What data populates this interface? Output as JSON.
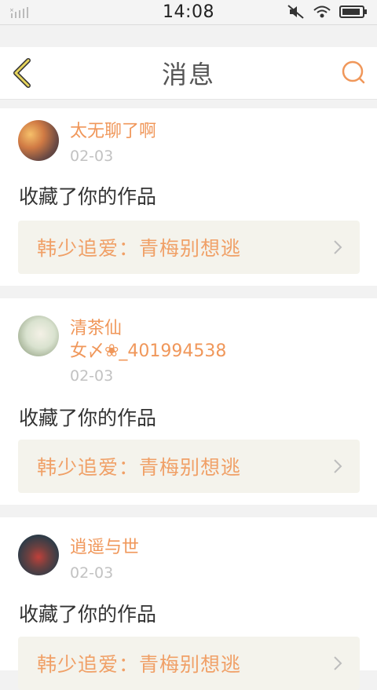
{
  "status_bar": {
    "time": "14:08"
  },
  "header": {
    "title": "消息"
  },
  "messages": [
    {
      "username": "太无聊了啊",
      "date": "02-03",
      "action": "收藏了你的作品",
      "work_title": "韩少追爱：青梅别想逃"
    },
    {
      "username_line1": "清茶仙",
      "username_line2": "女〆❀_401994538",
      "date": "02-03",
      "action": "收藏了你的作品",
      "work_title": "韩少追爱：青梅别想逃"
    },
    {
      "username": "逍遥与世",
      "date": "02-03",
      "action": "收藏了你的作品",
      "work_title": "韩少追爱：青梅别想逃"
    }
  ],
  "colors": {
    "accent": "#f0975a",
    "back_icon": "#d8b84a",
    "card_bg": "#f4f3ec"
  },
  "icons": {
    "back": "chevron-left-icon",
    "search": "search-icon",
    "arrow": "chevron-right-icon"
  }
}
